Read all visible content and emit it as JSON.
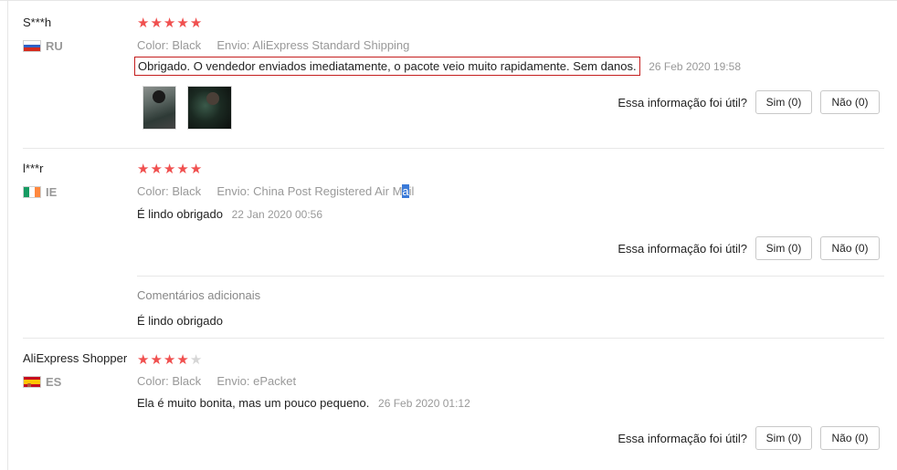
{
  "reviews": [
    {
      "user": "S***h",
      "country": "RU",
      "rating": 5,
      "color_label": "Color:",
      "color_value": "Black",
      "ship_label": "Envio:",
      "ship_value": "AliExpress Standard Shipping",
      "text": "Obrigado. O vendedor enviados imediatamente, o pacote veio muito rapidamente. Sem danos.",
      "date": "26 Feb 2020 19:58",
      "helpful_label": "Essa informação foi útil?",
      "yes_label": "Sim (0)",
      "no_label": "Não (0)"
    },
    {
      "user": "l***r",
      "country": "IE",
      "rating": 5,
      "color_label": "Color:",
      "color_value": "Black",
      "ship_label": "Envio:",
      "ship_value_pre": "China Post Registered Air M",
      "ship_value_hl": "a",
      "ship_value_post": "il",
      "text": "É lindo obrigado",
      "date": "22 Jan 2020 00:56",
      "helpful_label": "Essa informação foi útil?",
      "yes_label": "Sim (0)",
      "no_label": "Não (0)",
      "additional_label": "Comentários adicionais",
      "additional_text": "É lindo obrigado"
    },
    {
      "user": "AliExpress Shopper",
      "country": "ES",
      "rating": 4,
      "color_label": "Color:",
      "color_value": "Black",
      "ship_label": "Envio:",
      "ship_value": "ePacket",
      "text": "Ela é muito bonita, mas um pouco pequeno.",
      "date": "26 Feb 2020 01:12",
      "helpful_label": "Essa informação foi útil?",
      "yes_label": "Sim (0)",
      "no_label": "Não (0)"
    }
  ],
  "colors": {
    "star_on": "#f0504f",
    "star_off": "#d6d6d6",
    "highlight_border": "#c41e1e",
    "selection": "#3b7ad8"
  }
}
